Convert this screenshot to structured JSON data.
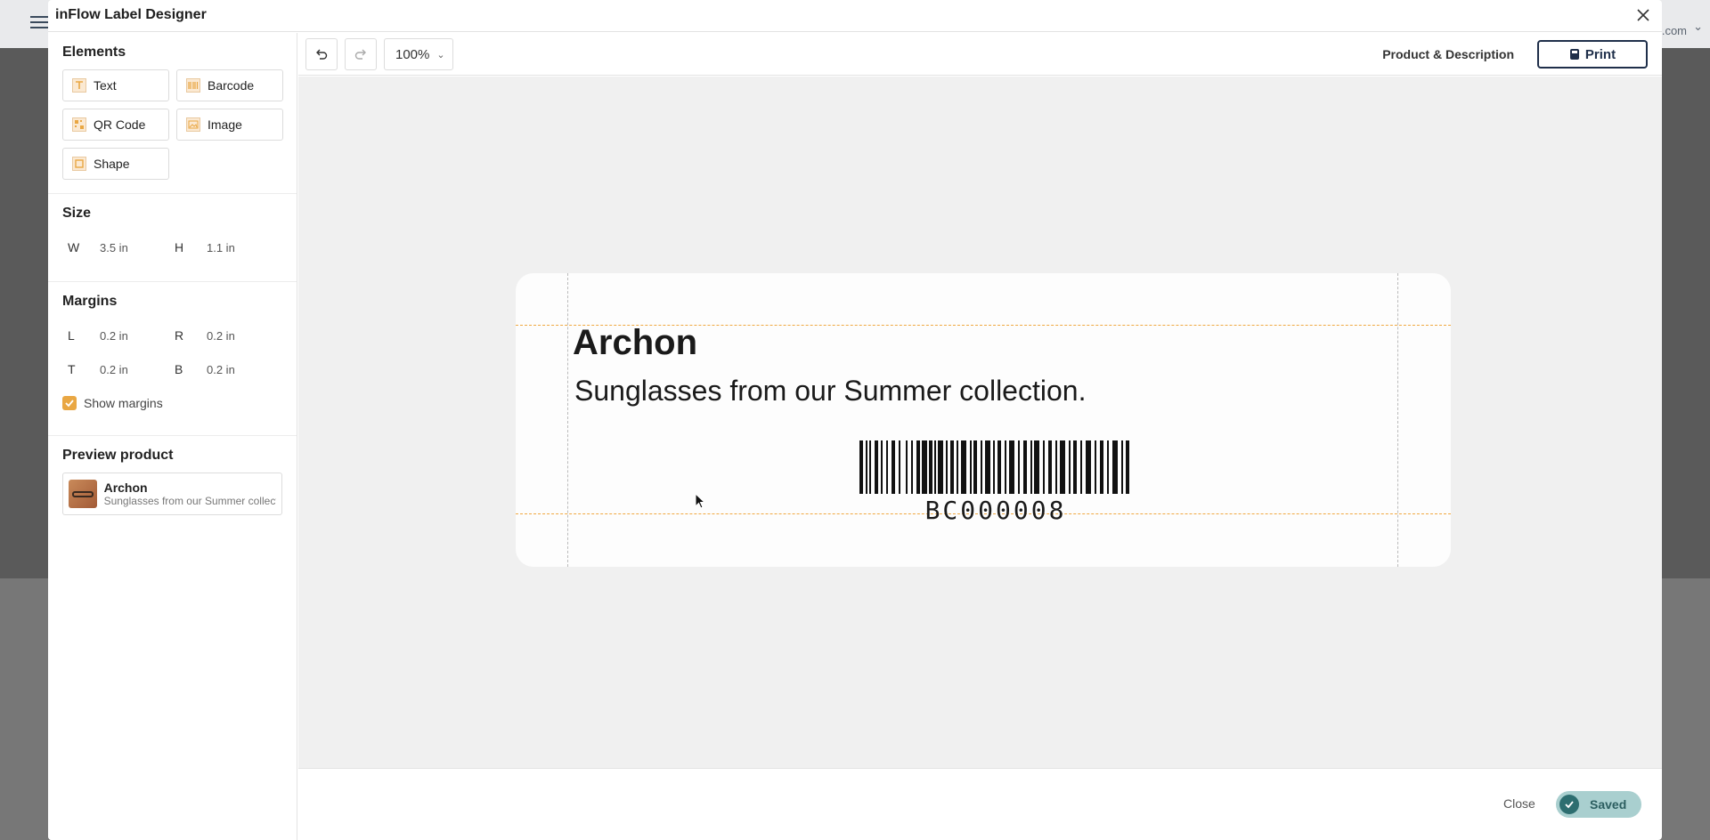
{
  "background": {
    "account_suffix": ".com"
  },
  "modal": {
    "title": "inFlow Label Designer"
  },
  "elements": {
    "title": "Elements",
    "items": [
      {
        "label": "Text",
        "icon": "text-icon"
      },
      {
        "label": "Barcode",
        "icon": "barcode-icon"
      },
      {
        "label": "QR Code",
        "icon": "qr-code-icon"
      },
      {
        "label": "Image",
        "icon": "image-icon"
      },
      {
        "label": "Shape",
        "icon": "shape-icon"
      }
    ]
  },
  "size": {
    "title": "Size",
    "w_key": "W",
    "w_value": "3.5 in",
    "h_key": "H",
    "h_value": "1.1 in"
  },
  "margins": {
    "title": "Margins",
    "l_key": "L",
    "l_value": "0.2 in",
    "r_key": "R",
    "r_value": "0.2 in",
    "t_key": "T",
    "t_value": "0.2 in",
    "b_key": "B",
    "b_value": "0.2 in",
    "show_margins_label": "Show margins",
    "show_margins_checked": true
  },
  "preview": {
    "title": "Preview product",
    "product_name": "Archon",
    "product_desc": "Sunglasses from our Summer collection."
  },
  "toolbar": {
    "zoom": "100%",
    "template_name": "Product & Description",
    "print_label": "Print"
  },
  "label": {
    "name": "Archon",
    "description": "Sunglasses from our Summer collection.",
    "barcode_value": "BC000008"
  },
  "footer": {
    "close_label": "Close",
    "saved_label": "Saved"
  },
  "colors": {
    "accent": "#e9a743",
    "primary_dark": "#1f2f4a",
    "saved_bg": "#a9cfcf",
    "saved_dot": "#2d6e70"
  }
}
